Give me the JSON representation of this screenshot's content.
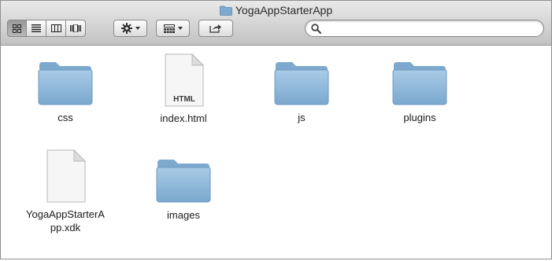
{
  "window": {
    "title": "YogaAppStarterApp"
  },
  "toolbar": {
    "view_modes": [
      {
        "name": "icon-view",
        "icon": "grid-icon",
        "active": true
      },
      {
        "name": "list-view",
        "icon": "list-icon",
        "active": false
      },
      {
        "name": "column-view",
        "icon": "columns-icon",
        "active": false
      },
      {
        "name": "coverflow-view",
        "icon": "coverflow-icon",
        "active": false
      }
    ],
    "action_icon": "gear-icon",
    "arrange_icon": "arrange-icon",
    "share_icon": "share-icon",
    "search": {
      "value": "",
      "placeholder": ""
    }
  },
  "files": [
    {
      "name": "css",
      "kind": "folder"
    },
    {
      "name": "index.html",
      "kind": "html-document",
      "badge": "HTML"
    },
    {
      "name": "js",
      "kind": "folder"
    },
    {
      "name": "plugins",
      "kind": "folder"
    },
    {
      "name": "YogaAppStarterApp.xdk",
      "kind": "document"
    },
    {
      "name": "images",
      "kind": "folder"
    }
  ],
  "colors": {
    "folder": "#8fb8d8",
    "folder_dark": "#6a98bf",
    "toolbar_top": "#e9e9e9",
    "toolbar_bottom": "#c2c2c2"
  }
}
